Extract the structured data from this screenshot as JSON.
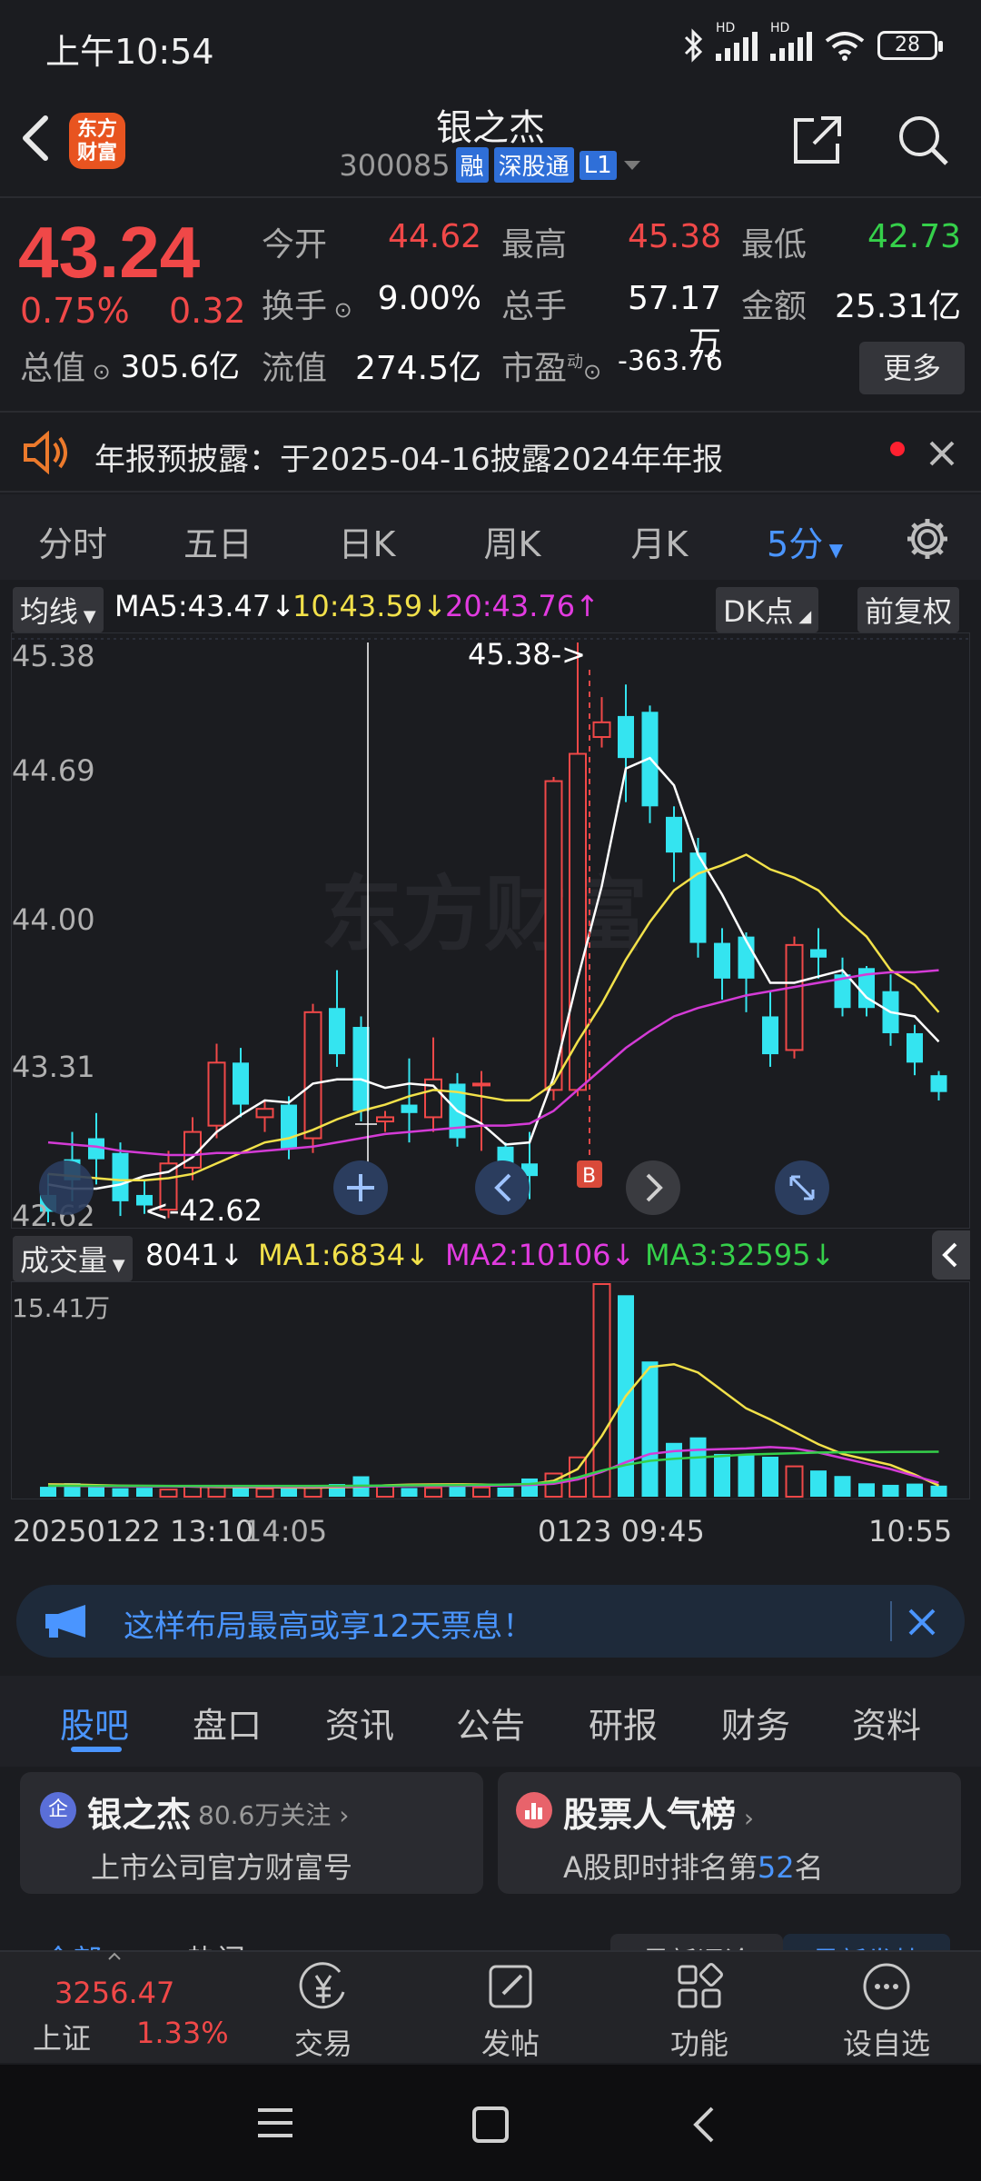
{
  "status_bar": {
    "time": "上午10:54",
    "hd1": "HD",
    "hd2": "HD",
    "battery": "28"
  },
  "header": {
    "logo_text": "东方财富",
    "stock_name": "银之杰",
    "stock_code": "300085",
    "tags": [
      "融",
      "深股通",
      "L1"
    ]
  },
  "quote": {
    "price": "43.24",
    "change_pct": "0.75%",
    "change_abs": "0.32",
    "fields": [
      {
        "label": "今开",
        "value": "44.62",
        "color": "#f04848"
      },
      {
        "label": "最高",
        "value": "45.38",
        "color": "#f04848"
      },
      {
        "label": "最低",
        "value": "42.73",
        "color": "#35d04a"
      },
      {
        "label": "换手",
        "value": "9.00%",
        "color": "#ffffff"
      },
      {
        "label": "总手",
        "value": "57.17万",
        "color": "#ffffff"
      },
      {
        "label": "金额",
        "value": "25.31亿",
        "color": "#ffffff"
      },
      {
        "label": "总值",
        "value": "305.6亿",
        "color": "#ffffff"
      },
      {
        "label": "流值",
        "value": "274.5亿",
        "color": "#ffffff"
      },
      {
        "label": "市盈",
        "value": "-363.76",
        "color": "#ffffff"
      }
    ],
    "pe_superscript": "动",
    "more_label": "更多"
  },
  "announcement": {
    "text": "年报预披露：于2025-04-16披露2024年年报"
  },
  "period_tabs": {
    "items": [
      "分时",
      "五日",
      "日K",
      "周K",
      "月K",
      "5分"
    ],
    "active": "5分"
  },
  "kline": {
    "indicator_chip": "均线",
    "ma5": "MA5:43.47",
    "ma10": "10:43.59",
    "ma20": "20:43.76",
    "dk_chip": "DK点",
    "adjust_chip": "前复权",
    "y_labels": [
      "45.38",
      "44.69",
      "44.00",
      "43.31",
      "42.62"
    ],
    "high_marker": "45.38->",
    "low_marker": "<-42.62",
    "buy_marker": "B",
    "watermark": "东方财富"
  },
  "volume": {
    "indicator_chip": "成交量",
    "current": "8041",
    "ma1": "MA1:6834",
    "ma2": "MA2:10106",
    "ma3": "MA3:32595",
    "y_label": "15.41万"
  },
  "time_axis": {
    "t1": "20250122 13:10",
    "t2": "14:05",
    "t3": "0123 09:45",
    "t4": "10:55"
  },
  "promo": {
    "text": "这样布局最高或享12天票息！"
  },
  "lower_tabs": {
    "items": [
      "股吧",
      "盘口",
      "资讯",
      "公告",
      "研报",
      "财务",
      "资料"
    ],
    "active": "股吧"
  },
  "cards": {
    "company": {
      "badge": "企",
      "name": "银之杰",
      "followers": "80.6万关注",
      "subtitle": "上市公司官方财富号"
    },
    "rank": {
      "title": "股票人气榜",
      "subtitle_prefix": "A股即时排名第",
      "rank": "52",
      "subtitle_suffix": "名"
    }
  },
  "sub_tabs": {
    "left1": "全部",
    "left2": "热门",
    "right1": "最新评论",
    "right2": "最新发帖"
  },
  "bottom_nav": {
    "index_value": "3256.47",
    "index_name": "上证",
    "index_change": "1.33%",
    "items": [
      "交易",
      "发帖",
      "功能",
      "设自选"
    ]
  },
  "chart_data": {
    "type": "candlestick",
    "y_range": [
      42.62,
      45.38
    ],
    "candles": [
      {
        "o": 42.75,
        "c": 42.67,
        "h": 42.85,
        "l": 42.62
      },
      {
        "o": 42.92,
        "c": 42.82,
        "h": 43.05,
        "l": 42.72
      },
      {
        "o": 43.02,
        "c": 42.92,
        "h": 43.14,
        "l": 42.8
      },
      {
        "o": 42.95,
        "c": 42.72,
        "h": 43.0,
        "l": 42.65
      },
      {
        "o": 42.75,
        "c": 42.7,
        "h": 42.82,
        "l": 42.66
      },
      {
        "o": 42.68,
        "c": 42.9,
        "h": 42.96,
        "l": 42.64
      },
      {
        "o": 42.88,
        "c": 43.05,
        "h": 43.12,
        "l": 42.82
      },
      {
        "o": 43.08,
        "c": 43.38,
        "h": 43.47,
        "l": 43.02
      },
      {
        "o": 43.38,
        "c": 43.18,
        "h": 43.45,
        "l": 43.12
      },
      {
        "o": 43.12,
        "c": 43.16,
        "h": 43.2,
        "l": 43.05
      },
      {
        "o": 43.18,
        "c": 42.97,
        "h": 43.22,
        "l": 42.92
      },
      {
        "o": 43.02,
        "c": 43.62,
        "h": 43.66,
        "l": 42.95
      },
      {
        "o": 43.64,
        "c": 43.42,
        "h": 43.82,
        "l": 43.36
      },
      {
        "o": 43.55,
        "c": 43.15,
        "h": 43.6,
        "l": 43.1
      },
      {
        "o": 43.1,
        "c": 43.12,
        "h": 43.15,
        "l": 43.05
      },
      {
        "o": 43.18,
        "c": 43.14,
        "h": 43.4,
        "l": 43.0
      },
      {
        "o": 43.12,
        "c": 43.3,
        "h": 43.5,
        "l": 43.05
      },
      {
        "o": 43.28,
        "c": 43.02,
        "h": 43.33,
        "l": 42.98
      },
      {
        "o": 43.28,
        "c": 43.28,
        "h": 43.34,
        "l": 42.96
      },
      {
        "o": 42.98,
        "c": 42.74,
        "h": 43.0,
        "l": 42.7
      },
      {
        "o": 42.9,
        "c": 42.84,
        "h": 43.05,
        "l": 42.73
      },
      {
        "o": 43.25,
        "c": 44.72,
        "h": 44.74,
        "l": 43.2
      },
      {
        "o": 43.25,
        "c": 44.85,
        "h": 45.38,
        "l": 43.22
      },
      {
        "o": 44.93,
        "c": 45.0,
        "h": 45.12,
        "l": 44.88
      },
      {
        "o": 45.03,
        "c": 44.83,
        "h": 45.18,
        "l": 44.62
      },
      {
        "o": 45.05,
        "c": 44.6,
        "h": 45.08,
        "l": 44.52
      },
      {
        "o": 44.55,
        "c": 44.38,
        "h": 44.6,
        "l": 44.24
      },
      {
        "o": 44.38,
        "c": 43.95,
        "h": 44.45,
        "l": 43.88
      },
      {
        "o": 43.95,
        "c": 43.78,
        "h": 44.02,
        "l": 43.68
      },
      {
        "o": 43.98,
        "c": 43.78,
        "h": 44.0,
        "l": 43.62
      },
      {
        "o": 43.6,
        "c": 43.42,
        "h": 43.72,
        "l": 43.36
      },
      {
        "o": 43.44,
        "c": 43.94,
        "h": 43.98,
        "l": 43.4
      },
      {
        "o": 43.92,
        "c": 43.88,
        "h": 44.02,
        "l": 43.78
      },
      {
        "o": 43.8,
        "c": 43.64,
        "h": 43.88,
        "l": 43.6
      },
      {
        "o": 43.83,
        "c": 43.64,
        "h": 43.84,
        "l": 43.6
      },
      {
        "o": 43.72,
        "c": 43.52,
        "h": 43.8,
        "l": 43.46
      },
      {
        "o": 43.52,
        "c": 43.38,
        "h": 43.56,
        "l": 43.32
      },
      {
        "o": 43.32,
        "c": 43.24,
        "h": 43.34,
        "l": 43.2
      }
    ],
    "ma5": [
      42.8,
      42.78,
      42.78,
      42.8,
      42.84,
      42.86,
      42.93,
      43.05,
      43.13,
      43.2,
      43.19,
      43.28,
      43.3,
      43.3,
      43.26,
      43.28,
      43.27,
      43.15,
      43.09,
      42.99,
      43.0,
      43.31,
      43.78,
      44.22,
      44.78,
      44.83,
      44.7,
      44.37,
      44.18,
      43.96,
      43.76,
      43.76,
      43.79,
      43.82,
      43.69,
      43.62,
      43.6,
      43.48
    ],
    "ma10": [
      42.85,
      42.84,
      42.83,
      42.82,
      42.82,
      42.83,
      42.85,
      42.9,
      42.95,
      43.0,
      43.02,
      43.06,
      43.11,
      43.15,
      43.18,
      43.22,
      43.25,
      43.24,
      43.22,
      43.2,
      43.2,
      43.28,
      43.48,
      43.66,
      43.87,
      44.05,
      44.2,
      44.28,
      44.32,
      44.37,
      44.3,
      44.26,
      44.2,
      44.08,
      43.98,
      43.82,
      43.75,
      43.62
    ],
    "ma20": [
      43.0,
      42.99,
      42.98,
      42.96,
      42.95,
      42.94,
      42.94,
      42.95,
      42.95,
      42.96,
      42.97,
      42.98,
      43.0,
      43.02,
      43.04,
      43.05,
      43.06,
      43.07,
      43.08,
      43.08,
      43.09,
      43.15,
      43.25,
      43.35,
      43.45,
      43.53,
      43.6,
      43.64,
      43.67,
      43.7,
      43.72,
      43.74,
      43.76,
      43.78,
      43.8,
      43.81,
      43.81,
      43.82
    ],
    "volume_range": [
      0,
      154100
    ],
    "volumes": [
      7200,
      9800,
      8600,
      6200,
      6500,
      5200,
      7300,
      7600,
      7100,
      5800,
      6200,
      6800,
      9200,
      14800,
      8200,
      6300,
      6400,
      7300,
      6700,
      6600,
      13200,
      16800,
      28500,
      154100,
      146000,
      98000,
      39000,
      43000,
      31000,
      30000,
      29000,
      22000,
      19000,
      15000,
      9700,
      8600,
      9500,
      8041
    ],
    "vol_ma1": [
      9000,
      8800,
      8400,
      8000,
      7800,
      7700,
      7300,
      7000,
      6900,
      6800,
      6700,
      6500,
      6800,
      7200,
      8200,
      8700,
      8900,
      9000,
      8800,
      8500,
      9000,
      11500,
      20000,
      44000,
      73000,
      94000,
      96000,
      90000,
      77000,
      64000,
      56000,
      47000,
      38000,
      31000,
      27000,
      23000,
      16000,
      8041
    ],
    "vol_ma2": [
      8000,
      7800,
      7600,
      7600,
      7500,
      7500,
      7400,
      7300,
      7300,
      7200,
      7200,
      7200,
      7300,
      7400,
      7600,
      7700,
      7800,
      7900,
      8000,
      8200,
      8500,
      9400,
      12500,
      18000,
      25000,
      31000,
      33000,
      34000,
      34500,
      35000,
      36000,
      35000,
      32000,
      28000,
      24000,
      20000,
      15000,
      10106
    ],
    "vol_ma3": [
      8000,
      8000,
      7900,
      7900,
      7900,
      7800,
      7800,
      7800,
      7800,
      7800,
      7800,
      7800,
      7900,
      8000,
      8100,
      8200,
      8300,
      8400,
      8600,
      8800,
      9200,
      10500,
      14000,
      19000,
      23000,
      26000,
      27500,
      28500,
      29500,
      30500,
      31000,
      31500,
      32000,
      32200,
      32300,
      32400,
      32500,
      32595
    ]
  }
}
